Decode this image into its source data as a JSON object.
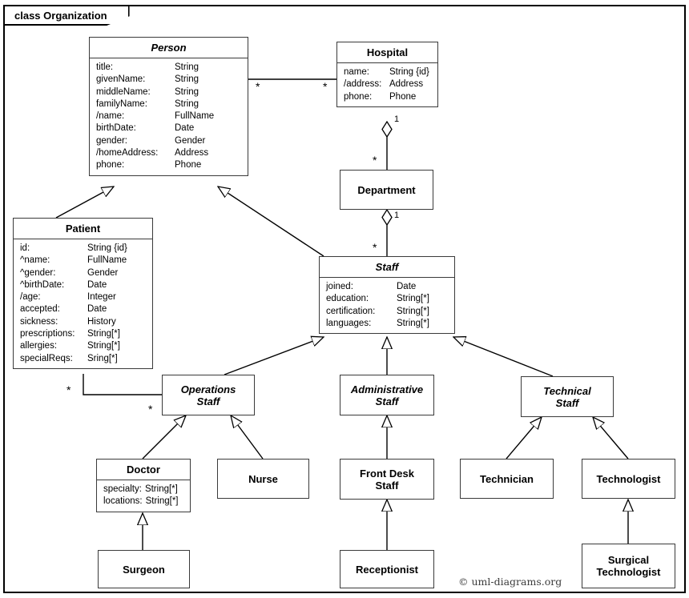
{
  "frame": {
    "tab_label": "class Organization"
  },
  "copyright": "© uml-diagrams.org",
  "classes": {
    "person": {
      "name": "Person",
      "attrs": [
        {
          "name": "title:",
          "type": "String"
        },
        {
          "name": "givenName:",
          "type": "String"
        },
        {
          "name": "middleName:",
          "type": "String"
        },
        {
          "name": "familyName:",
          "type": "String"
        },
        {
          "name": "/name:",
          "type": "FullName"
        },
        {
          "name": "birthDate:",
          "type": "Date"
        },
        {
          "name": "gender:",
          "type": "Gender"
        },
        {
          "name": "/homeAddress:",
          "type": "Address"
        },
        {
          "name": "phone:",
          "type": "Phone"
        }
      ]
    },
    "hospital": {
      "name": "Hospital",
      "attrs": [
        {
          "name": "name:",
          "type": "String {id}"
        },
        {
          "name": "/address:",
          "type": "Address"
        },
        {
          "name": "phone:",
          "type": "Phone"
        }
      ]
    },
    "department": {
      "name": "Department"
    },
    "patient": {
      "name": "Patient",
      "attrs": [
        {
          "name": "id:",
          "type": "String {id}"
        },
        {
          "name": "^name:",
          "type": "FullName"
        },
        {
          "name": "^gender:",
          "type": "Gender"
        },
        {
          "name": "^birthDate:",
          "type": "Date"
        },
        {
          "name": "/age:",
          "type": "Integer"
        },
        {
          "name": "accepted:",
          "type": "Date"
        },
        {
          "name": "sickness:",
          "type": "History"
        },
        {
          "name": "prescriptions:",
          "type": "String[*]"
        },
        {
          "name": "allergies:",
          "type": "String[*]"
        },
        {
          "name": "specialReqs:",
          "type": "Sring[*]"
        }
      ]
    },
    "staff": {
      "name": "Staff",
      "attrs": [
        {
          "name": "joined:",
          "type": "Date"
        },
        {
          "name": "education:",
          "type": "String[*]"
        },
        {
          "name": "certification:",
          "type": "String[*]"
        },
        {
          "name": "languages:",
          "type": "String[*]"
        }
      ]
    },
    "operations_staff": {
      "name": "Operations\nStaff"
    },
    "administrative_staff": {
      "name": "Administrative\nStaff"
    },
    "technical_staff": {
      "name": "Technical\nStaff"
    },
    "doctor": {
      "name": "Doctor",
      "attrs": [
        {
          "name": "specialty:",
          "type": "String[*]"
        },
        {
          "name": "locations:",
          "type": "String[*]"
        }
      ]
    },
    "nurse": {
      "name": "Nurse"
    },
    "front_desk_staff": {
      "name": "Front Desk\nStaff"
    },
    "technician": {
      "name": "Technician"
    },
    "technologist": {
      "name": "Technologist"
    },
    "surgeon": {
      "name": "Surgeon"
    },
    "receptionist": {
      "name": "Receptionist"
    },
    "surgical_technologist": {
      "name": "Surgical\nTechnologist"
    }
  },
  "multiplicities": {
    "person_hospital_left": "*",
    "person_hospital_right": "*",
    "hospital_department_one": "1",
    "hospital_department_many": "*",
    "department_staff_one": "1",
    "department_staff_many": "*",
    "patient_ops_patient_end": "*",
    "patient_ops_staff_end": "*"
  }
}
